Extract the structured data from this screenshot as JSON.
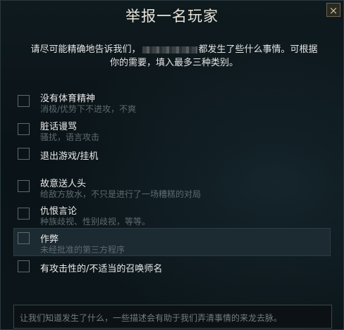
{
  "dialog": {
    "title": "举报一名玩家",
    "close_icon": "×",
    "intro_part1": "请尽可能精确地告诉我们，",
    "intro_part2": "都发生了些什么事情。可根据",
    "intro_line2": "你的需要，填入最多三种类别。"
  },
  "options": [
    {
      "label": "没有体育精神",
      "sub": "消极/优势下不进攻，不爽"
    },
    {
      "label": "脏话谩骂",
      "sub": "骚扰，语言攻击"
    },
    {
      "label": "退出游戏/挂机",
      "sub": ""
    },
    {
      "label": "故意送人头",
      "sub": "给敌方放水，不只是进行了一场糟糕的对局"
    },
    {
      "label": "仇恨言论",
      "sub": "种族歧视、性别歧视，等等。"
    },
    {
      "label": "作弊",
      "sub": "未经批准的第三方程序"
    },
    {
      "label": "有攻击性的/不适当的召唤师名",
      "sub": ""
    }
  ],
  "comment": {
    "placeholder": "让我们知道发生了什么，一些描述会有助于我们弄清事情的来龙去脉。"
  }
}
